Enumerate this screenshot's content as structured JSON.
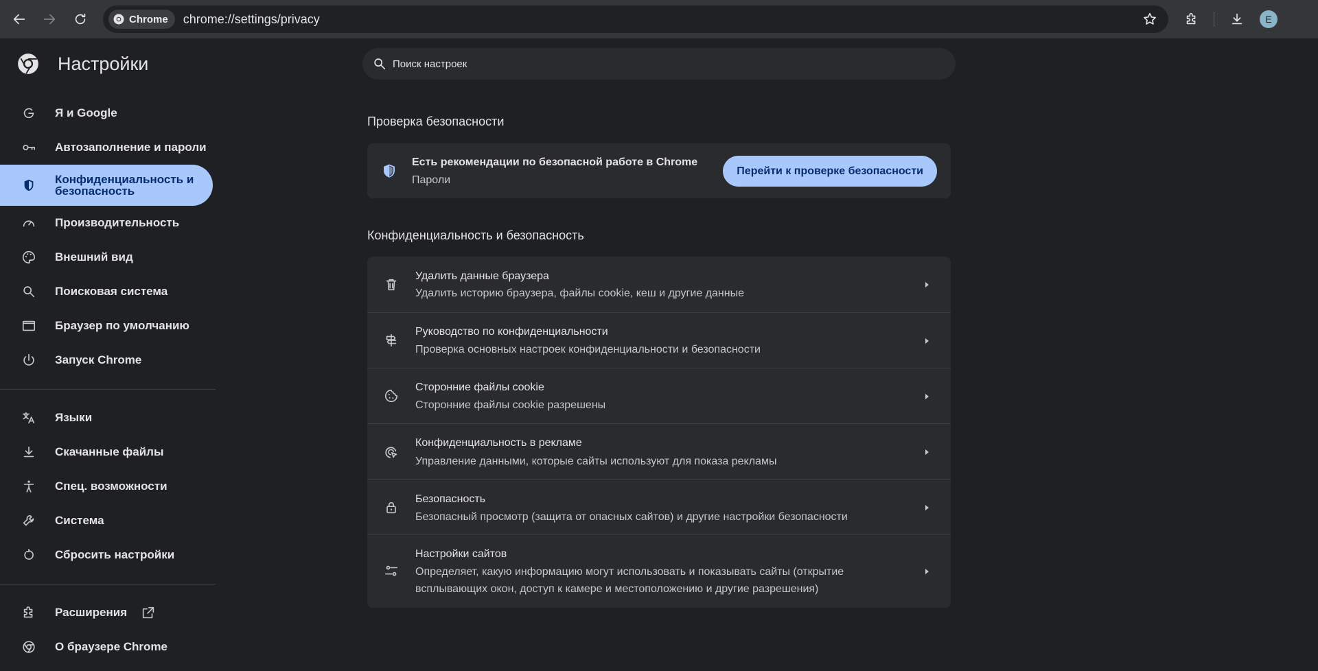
{
  "browser": {
    "chip_label": "Chrome",
    "url": "chrome://settings/privacy",
    "avatar_letter": "E"
  },
  "sidebar": {
    "title": "Настройки",
    "items": [
      {
        "label": "Я и Google",
        "icon": "google-icon"
      },
      {
        "label": "Автозаполнение и пароли",
        "icon": "key-icon"
      },
      {
        "label": "Конфиденциальность и безопасность",
        "icon": "shield-icon",
        "active": true
      },
      {
        "label": "Производительность",
        "icon": "speedometer-icon"
      },
      {
        "label": "Внешний вид",
        "icon": "palette-icon"
      },
      {
        "label": "Поисковая система",
        "icon": "search-icon"
      },
      {
        "label": "Браузер по умолчанию",
        "icon": "browser-window-icon"
      },
      {
        "label": "Запуск Chrome",
        "icon": "power-icon"
      },
      {
        "label": "Языки",
        "icon": "translate-icon"
      },
      {
        "label": "Скачанные файлы",
        "icon": "download-icon"
      },
      {
        "label": "Спец. возможности",
        "icon": "accessibility-icon"
      },
      {
        "label": "Система",
        "icon": "wrench-icon"
      },
      {
        "label": "Сбросить настройки",
        "icon": "reset-icon"
      },
      {
        "label": "Расширения",
        "icon": "extension-icon"
      },
      {
        "label": "О браузере Chrome",
        "icon": "chrome-icon"
      }
    ]
  },
  "search": {
    "placeholder": "Поиск настроек"
  },
  "safety_check": {
    "heading": "Проверка безопасности",
    "title": "Есть рекомендации по безопасной работе в Chrome",
    "subtitle": "Пароли",
    "button": "Перейти к проверке безопасности"
  },
  "privacy": {
    "heading": "Конфиденциальность и безопасность",
    "rows": [
      {
        "title": "Удалить данные браузера",
        "desc": "Удалить историю браузера, файлы cookie, кеш и другие данные",
        "icon": "trash-icon"
      },
      {
        "title": "Руководство по конфиденциальности",
        "desc": "Проверка основных настроек конфиденциальности и безопасности",
        "icon": "signpost-icon"
      },
      {
        "title": "Сторонние файлы cookie",
        "desc": "Сторонние файлы cookie разрешены",
        "icon": "cookie-icon"
      },
      {
        "title": "Конфиденциальность в рекламе",
        "desc": "Управление данными, которые сайты используют для показа рекламы",
        "icon": "ad-privacy-icon"
      },
      {
        "title": "Безопасность",
        "desc": "Безопасный просмотр (защита от опасных сайтов) и другие настройки безопасности",
        "icon": "lock-icon"
      },
      {
        "title": "Настройки сайтов",
        "desc": "Определяет, какую информацию могут использовать и показывать сайты (открытие всплывающих окон, доступ к камере и местоположению и другие разрешения)",
        "icon": "sliders-icon"
      }
    ]
  }
}
